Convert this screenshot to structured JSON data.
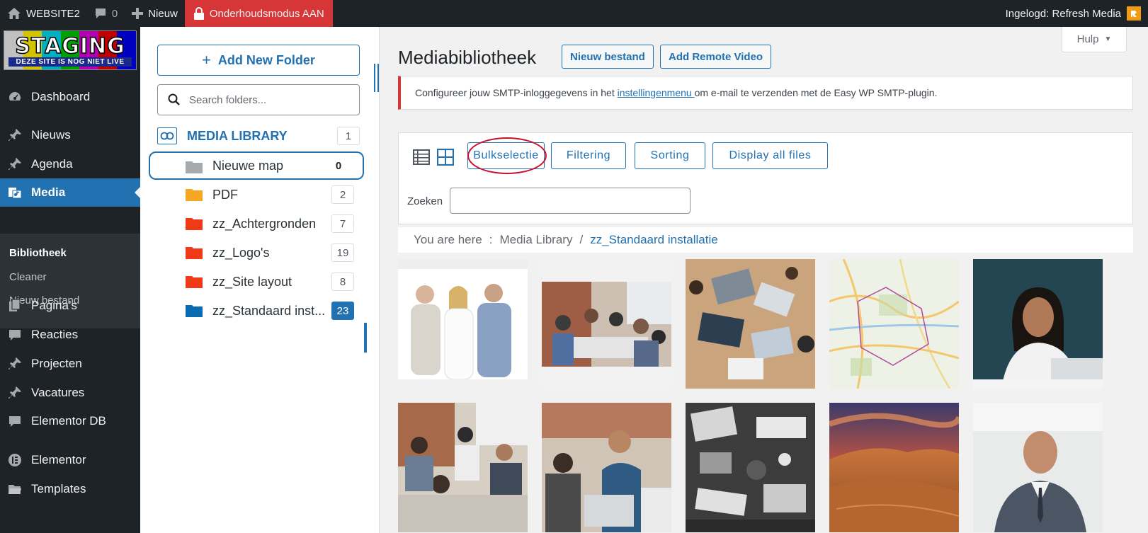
{
  "adminbar": {
    "site_name": "WEBSITE2",
    "comments_count": "0",
    "new_label": "Nieuw",
    "maintenance_label": "Onderhoudsmodus AAN",
    "user_label": "Ingelogd: Refresh Media"
  },
  "staging_logo": {
    "title": "STAGING",
    "subtitle": "DEZE SITE IS NOG NIET LIVE"
  },
  "menu": {
    "items": [
      {
        "label": "Dashboard",
        "icon": "dashboard-icon"
      },
      {
        "label": "Nieuws",
        "icon": "pin-icon"
      },
      {
        "label": "Agenda",
        "icon": "pin-icon"
      },
      {
        "label": "Media",
        "icon": "media-icon",
        "active": true
      },
      {
        "label": "Pagina’s",
        "icon": "page-icon"
      },
      {
        "label": "Reacties",
        "icon": "comment-icon"
      },
      {
        "label": "Projecten",
        "icon": "pin-icon"
      },
      {
        "label": "Vacatures",
        "icon": "pin-icon"
      },
      {
        "label": "Elementor DB",
        "icon": "comment-icon"
      },
      {
        "label": "Elementor",
        "icon": "elementor-icon"
      },
      {
        "label": "Templates",
        "icon": "folder-icon"
      }
    ],
    "submenu": [
      "Bibliotheek",
      "Cleaner",
      "Nieuw bestand"
    ]
  },
  "folders": {
    "add_button": "Add New Folder",
    "search_placeholder": "Search folders...",
    "root_label": "MEDIA LIBRARY",
    "root_count": "1",
    "items": [
      {
        "name": "Nieuwe map",
        "count": "0",
        "color": "#a7aaad"
      },
      {
        "name": "PDF",
        "count": "2",
        "color": "#f5a623"
      },
      {
        "name": "zz_Achtergronden",
        "count": "7",
        "color": "#f03a17"
      },
      {
        "name": "zz_Logo's",
        "count": "19",
        "color": "#f03a17"
      },
      {
        "name": "zz_Site layout",
        "count": "8",
        "color": "#f03a17"
      },
      {
        "name": "zz_Standaard inst...",
        "count": "23",
        "color": "#0a6bb0"
      }
    ]
  },
  "main": {
    "title": "Mediabibliotheek",
    "new_file_button": "Nieuw bestand",
    "add_remote_button": "Add Remote Video",
    "help_label": "Hulp",
    "notice_before": "Configureer jouw SMTP-inloggegevens in het ",
    "notice_link": "instellingenmenu ",
    "notice_after": "om e-mail te verzenden met de Easy WP SMTP-plugin.",
    "toolbar": {
      "bulk": "Bulkselectie",
      "filtering": "Filtering",
      "sorting": "Sorting",
      "display_all": "Display all files",
      "search_label": "Zoeken"
    },
    "breadcrumb": {
      "prefix": "You are here",
      "colon": ":",
      "root": "Media Library",
      "sep": "/",
      "current": "zz_Standaard installatie"
    }
  },
  "colors": {
    "accent": "#2271b1",
    "adminbar_bg": "#1d2327",
    "maintenance_bg": "#d63638",
    "notice_border": "#d63638"
  }
}
